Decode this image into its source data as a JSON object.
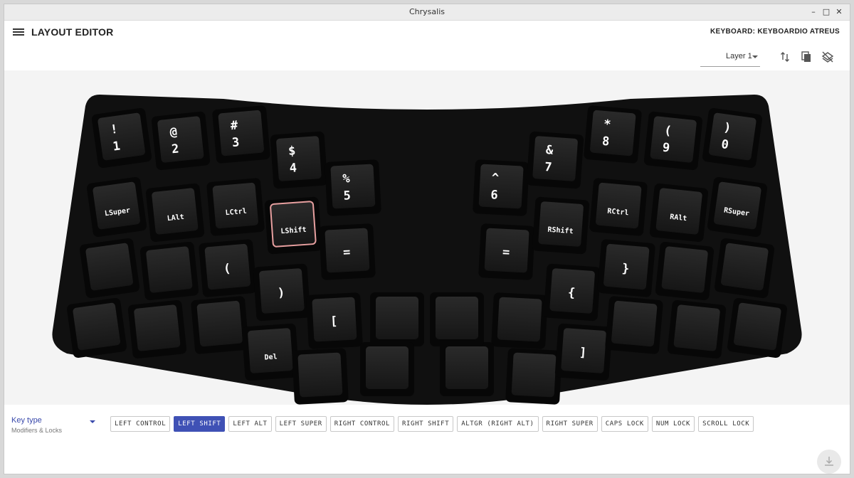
{
  "window": {
    "title": "Chrysalis"
  },
  "appbar": {
    "title": "LAYOUT EDITOR",
    "keyboard_label": "KEYBOARD: KEYBOARDIO ATREUS",
    "layer": "Layer 1"
  },
  "keyboard": {
    "left_keys": [
      {
        "shift": "!",
        "main": "1"
      },
      {
        "shift": "@",
        "main": "2"
      },
      {
        "shift": "#",
        "main": "3"
      },
      {
        "shift": "$",
        "main": "4"
      },
      {
        "shift": "%",
        "main": "5"
      },
      {
        "main": "LSuper"
      },
      {
        "main": "LAlt"
      },
      {
        "main": "LCtrl"
      },
      {
        "main": "LShift",
        "selected": true
      },
      {
        "main": "="
      },
      {
        "main": ""
      },
      {
        "main": ""
      },
      {
        "main": "("
      },
      {
        "main": ")"
      },
      {
        "main": "["
      },
      {
        "main": ""
      },
      {
        "main": ""
      },
      {
        "main": ""
      },
      {
        "main": "Del"
      },
      {
        "main": ""
      },
      {
        "main": ""
      },
      {
        "main": ""
      }
    ],
    "right_keys": [
      {
        "shift": "^",
        "main": "6"
      },
      {
        "shift": "&",
        "main": "7"
      },
      {
        "shift": "*",
        "main": "8"
      },
      {
        "shift": "(",
        "main": "9"
      },
      {
        "shift": ")",
        "main": "0"
      },
      {
        "main": "="
      },
      {
        "main": "RShift"
      },
      {
        "main": "RCtrl"
      },
      {
        "main": "RAlt"
      },
      {
        "main": "RSuper"
      },
      {
        "main": ""
      },
      {
        "main": "{"
      },
      {
        "main": "}"
      },
      {
        "main": ""
      },
      {
        "main": ""
      },
      {
        "main": ""
      },
      {
        "main": "]"
      },
      {
        "main": ""
      },
      {
        "main": ""
      },
      {
        "main": ""
      },
      {
        "main": ""
      },
      {
        "main": ""
      }
    ]
  },
  "editor": {
    "key_type_label": "Key type",
    "key_type_value": "Modifiers & Locks",
    "modifiers": [
      "LEFT CONTROL",
      "LEFT SHIFT",
      "LEFT ALT",
      "LEFT SUPER",
      "RIGHT CONTROL",
      "RIGHT SHIFT",
      "ALTGR (RIGHT ALT)",
      "RIGHT SUPER",
      "CAPS LOCK",
      "NUM LOCK",
      "SCROLL LOCK"
    ],
    "selected_modifier": "LEFT SHIFT"
  },
  "colors": {
    "accent": "#3f51b5",
    "keyboard_body": "#111111",
    "key_cap": "#1e1e1e",
    "selection": "#e8a0a0"
  },
  "icons": [
    "menu-icon",
    "swap-vert-icon",
    "copy-icon",
    "layers-clear-icon",
    "download-icon"
  ]
}
